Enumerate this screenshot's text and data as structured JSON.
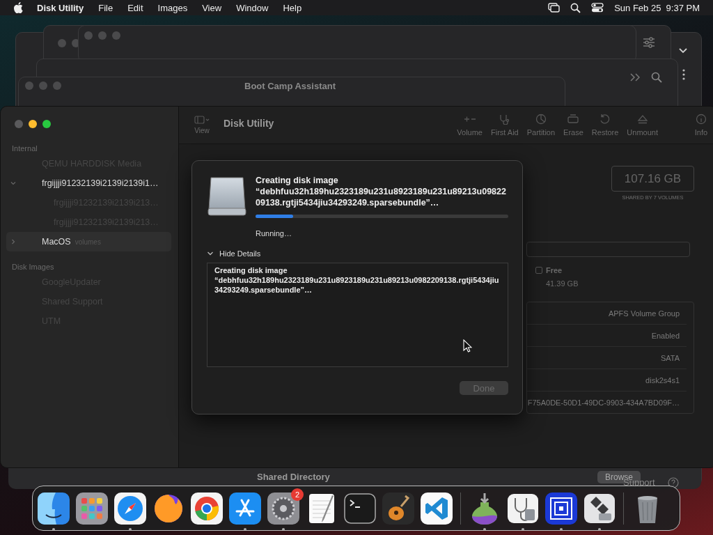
{
  "menu_bar": {
    "app_name": "Disk Utility",
    "menus": [
      "File",
      "Edit",
      "Images",
      "View",
      "Window",
      "Help"
    ],
    "clock": "Sun Feb 25  9:37 PM"
  },
  "background_windows": [
    {
      "title": "Boot Camp Assistant"
    }
  ],
  "background_panel": {
    "label": "Shared Directory",
    "button": "Browse",
    "link": "Support"
  },
  "toolbar": {
    "view_label": "View",
    "title": "Disk Utility",
    "buttons": [
      {
        "kind": "volume",
        "label": "Volume",
        "disabled": true
      },
      {
        "kind": "first_aid",
        "label": "First Aid",
        "disabled": true
      },
      {
        "kind": "partition",
        "label": "Partition",
        "disabled": true
      },
      {
        "kind": "erase",
        "label": "Erase",
        "disabled": true
      },
      {
        "kind": "restore",
        "label": "Restore",
        "disabled": true
      },
      {
        "kind": "unmount",
        "label": "Unmount",
        "disabled": true
      },
      {
        "kind": "info",
        "label": "Info",
        "disabled": true
      }
    ]
  },
  "sidebar": {
    "sections": [
      {
        "header": "Internal",
        "items": [
          {
            "label": "QEMU HARDDISK Media",
            "dimmed": true,
            "selected": false
          },
          {
            "label": "frgijjji91232139i2139i2139i1…",
            "dimmed": false,
            "selected": false,
            "expanded": true,
            "children": [
              {
                "label": "frgijjji91232139i2139i213…",
                "dimmed": true,
                "selected": false
              },
              {
                "label": "frgijjji91232139i2139i213…",
                "dimmed": true,
                "selected": false
              }
            ]
          },
          {
            "label": "MacOS",
            "sublabel": "volumes",
            "dimmed": false,
            "selected": true,
            "expanded": false
          }
        ]
      },
      {
        "header": "Disk Images",
        "items": [
          {
            "label": "GoogleUpdater",
            "dimmed": true,
            "selected": false
          },
          {
            "label": "Shared Support",
            "dimmed": true,
            "selected": false
          },
          {
            "label": "UTM",
            "dimmed": true,
            "selected": false
          }
        ]
      }
    ]
  },
  "details": {
    "capacity": "107.16 GB",
    "capacity_caption": "SHARED BY 7 VOLUMES",
    "legend": {
      "label": "Free",
      "value": "41.39 GB"
    },
    "info_values": [
      "APFS Volume Group",
      "Enabled",
      "SATA",
      "disk2s4s1",
      "F75A0DE-50D1-49DC-9903-434A7BD09F…"
    ]
  },
  "sheet": {
    "title": "Creating disk image “debhfuu32h189hu2323189u231u8923189u231u89213u0982209138.rgtji5434jiu34293249.sparsebundle”…",
    "progress": {
      "level": 0.15
    },
    "status": "Running…",
    "details_toggle": {
      "label": "Hide Details",
      "expanded": true
    },
    "details": "Creating disk image “debhfuu32h189hu2323189u231u8923189u231u89213u0982209138.rgtji5434jiu34293249.sparsebundle”…",
    "done_button": {
      "label": "Done",
      "disabled": true
    }
  },
  "dock": {
    "items": [
      {
        "kind": "finder",
        "running": true
      },
      {
        "kind": "launchpad",
        "running": false
      },
      {
        "kind": "safari",
        "running": true
      },
      {
        "kind": "firefox",
        "running": false
      },
      {
        "kind": "chrome",
        "running": false
      },
      {
        "kind": "appstore",
        "running": true
      },
      {
        "kind": "settings",
        "running": true,
        "badge": "2"
      },
      {
        "kind": "textedit",
        "running": false
      },
      {
        "kind": "terminal",
        "running": false
      },
      {
        "kind": "garageband",
        "running": false
      },
      {
        "kind": "vscode",
        "running": false
      },
      {
        "kind": "separator"
      },
      {
        "kind": "installer",
        "running": true
      },
      {
        "kind": "diskutility",
        "running": true
      },
      {
        "kind": "utm",
        "running": true
      },
      {
        "kind": "bootcamp",
        "running": true
      },
      {
        "kind": "separator"
      },
      {
        "kind": "trash",
        "running": false
      }
    ]
  }
}
